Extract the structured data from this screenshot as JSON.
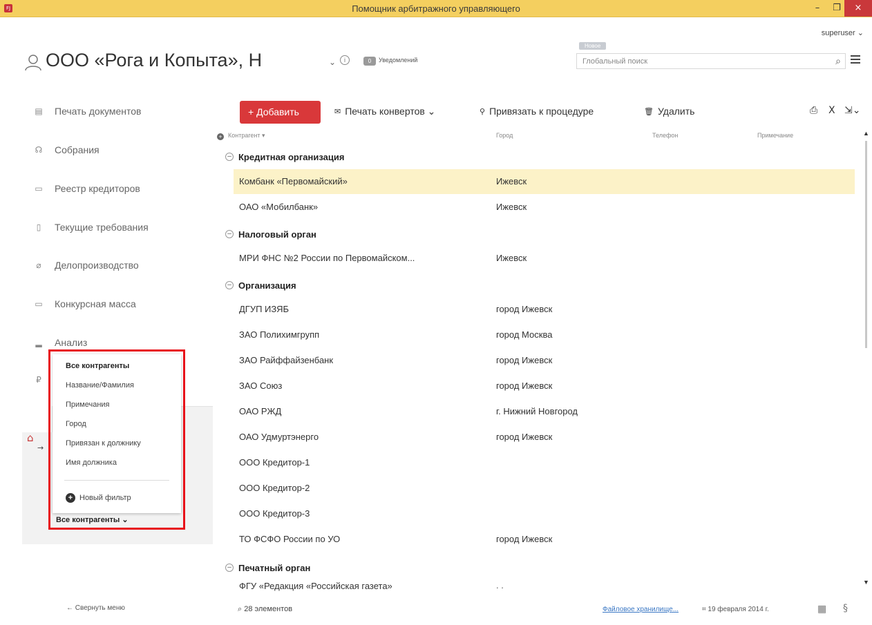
{
  "window": {
    "title": "Помощник арбитражного управляющего",
    "app_icon": "FJ",
    "minimize": "–",
    "maximize": "❐",
    "close": "×"
  },
  "header": {
    "user": "superuser",
    "user_chevron": "⌄",
    "org_title": "ООО «Рога и Копыта», Н",
    "org_chevron": "⌄",
    "info_glyph": "i",
    "notifications_count": "0",
    "notifications_label": "Уведомлений",
    "new_tag": "Новое",
    "search_placeholder": "Глобальный поиск",
    "search_glyph": "⌕"
  },
  "sidebar": {
    "items": [
      {
        "label": "Печать документов",
        "icon": "document-icon",
        "glyph": "▤"
      },
      {
        "label": "Собрания",
        "icon": "meeting-icon",
        "glyph": "☊"
      },
      {
        "label": "Реестр кредиторов",
        "icon": "registry-icon",
        "glyph": "▭"
      },
      {
        "label": "Текущие требования",
        "icon": "clipboard-icon",
        "glyph": "▯"
      },
      {
        "label": "Делопроизводство",
        "icon": "paperclip-icon",
        "glyph": "⌀"
      },
      {
        "label": "Конкурсная масса",
        "icon": "box-icon",
        "glyph": "▭"
      },
      {
        "label": "Анализ",
        "icon": "chart-icon",
        "glyph": "▂"
      },
      {
        "label": "",
        "icon": "ruble-icon",
        "glyph": "₽"
      }
    ],
    "bank_glyph": "⌂",
    "arrow_glyph": "→",
    "collapse_label": "← Свернуть меню"
  },
  "filter_menu": {
    "items": [
      "Все контрагенты",
      "Название/Фамилия",
      "Примечания",
      "Город",
      "Привязан к должнику",
      "Имя должника"
    ],
    "new_filter_label": "Новый фильтр",
    "new_filter_glyph": "+",
    "current": "Все контрагенты ⌄"
  },
  "toolbar": {
    "add_label": "+ Добавить",
    "print_envelopes_glyph": "✉",
    "print_envelopes_label": "Печать конвертов ⌄",
    "bind_glyph": "⚲",
    "bind_label": "Привязать к процедуре",
    "delete_glyph": "🗑",
    "delete_label": "Удалить",
    "print_glyph": "⎙",
    "excel_glyph": "X",
    "export_glyph": "⇲⌄"
  },
  "grid": {
    "expand_glyph": "+",
    "collapse_glyph": "–",
    "columns": [
      "Контрагент ▾",
      "Город",
      "Телефон",
      "Примечание"
    ],
    "groups": [
      {
        "name": "Кредитная организация",
        "rows": [
          {
            "name": "Комбанк «Первомайский»",
            "city": "Ижевск",
            "selected": true
          },
          {
            "name": "ОАО «Мобилбанк»",
            "city": "Ижевск",
            "selected": false
          }
        ]
      },
      {
        "name": "Налоговый орган",
        "rows": [
          {
            "name": "МРИ ФНС №2 России по Первомайском...",
            "city": "Ижевск",
            "selected": false
          }
        ]
      },
      {
        "name": "Организация",
        "rows": [
          {
            "name": "ДГУП ИЗЯБ",
            "city": "город Ижевск",
            "selected": false
          },
          {
            "name": "ЗАО Полихимгрупп",
            "city": "город Москва",
            "selected": false
          },
          {
            "name": "ЗАО Райффайзенбанк",
            "city": "город Ижевск",
            "selected": false
          },
          {
            "name": "ЗАО Союз",
            "city": "город Ижевск",
            "selected": false
          },
          {
            "name": "ОАО РЖД",
            "city": "г. Нижний Новгород",
            "selected": false
          },
          {
            "name": "ОАО Удмуртэнерго",
            "city": "город Ижевск",
            "selected": false
          },
          {
            "name": "ООО Кредитор-1",
            "city": "",
            "selected": false
          },
          {
            "name": "ООО Кредитор-2",
            "city": "",
            "selected": false
          },
          {
            "name": "ООО Кредитор-3",
            "city": "",
            "selected": false
          },
          {
            "name": "ТО ФСФО России по УО",
            "city": "город Ижевск",
            "selected": false
          }
        ]
      },
      {
        "name": "Печатный орган",
        "rows": []
      }
    ],
    "partial_row": "ФГУ «Редакция «Российская газета»",
    "partial_dots": ". .",
    "scroll_up": "▲",
    "scroll_down": "▼"
  },
  "status_bar": {
    "count": "⌕ 28 элементов",
    "storage_link": "Файловое хранилище...",
    "date": "⌗ 19 февраля 2014 г.",
    "calc_glyph": "▦",
    "section_glyph": "§"
  },
  "colors": {
    "titlebar": "#f4cf5f",
    "accent_red": "#d9383a",
    "selection": "#fcf2c8",
    "highlight_frame": "#e8121a",
    "link": "#3a77c4"
  }
}
